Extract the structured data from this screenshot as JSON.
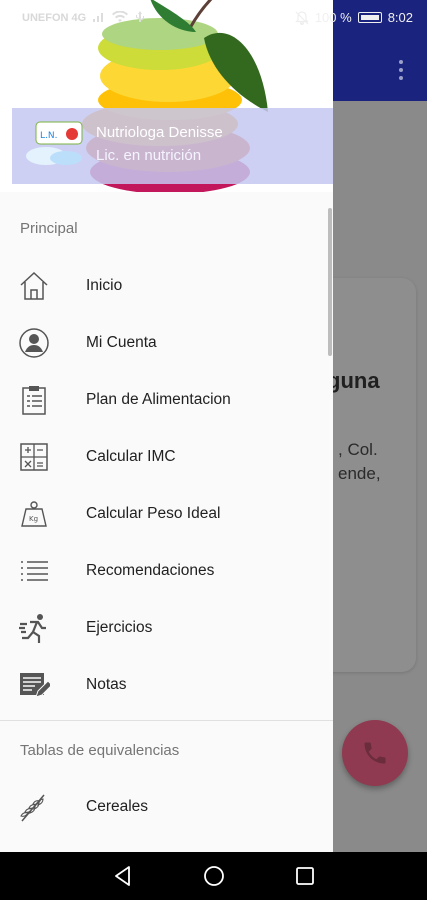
{
  "status_bar": {
    "carrier": "UNEFON 4G",
    "battery_text": "100 %",
    "time": "8:02"
  },
  "background_app": {
    "card_title_fragment": "guna",
    "card_line_1": ", Col.",
    "card_line_2": "ende,"
  },
  "drawer": {
    "profile": {
      "name": "Nutriologa Denisse",
      "subtitle": "Lic. en nutrición",
      "logo_text": "L.N."
    },
    "sections": [
      {
        "title": "Principal",
        "items": [
          {
            "label": "Inicio",
            "icon": "home-icon"
          },
          {
            "label": "Mi Cuenta",
            "icon": "account-icon"
          },
          {
            "label": "Plan de Alimentacion",
            "icon": "clipboard-icon"
          },
          {
            "label": "Calcular IMC",
            "icon": "calculator-icon"
          },
          {
            "label": "Calcular Peso Ideal",
            "icon": "weight-icon"
          },
          {
            "label": "Recomendaciones",
            "icon": "list-icon"
          },
          {
            "label": "Ejercicios",
            "icon": "runner-icon"
          },
          {
            "label": "Notas",
            "icon": "notes-icon"
          }
        ]
      },
      {
        "title": "Tablas de equivalencias",
        "items": [
          {
            "label": "Cereales",
            "icon": "grain-icon"
          }
        ]
      }
    ]
  },
  "colors": {
    "toolbar": "#1a237e",
    "fab": "#8f3a50",
    "drawer_bg": "#fafafa"
  }
}
